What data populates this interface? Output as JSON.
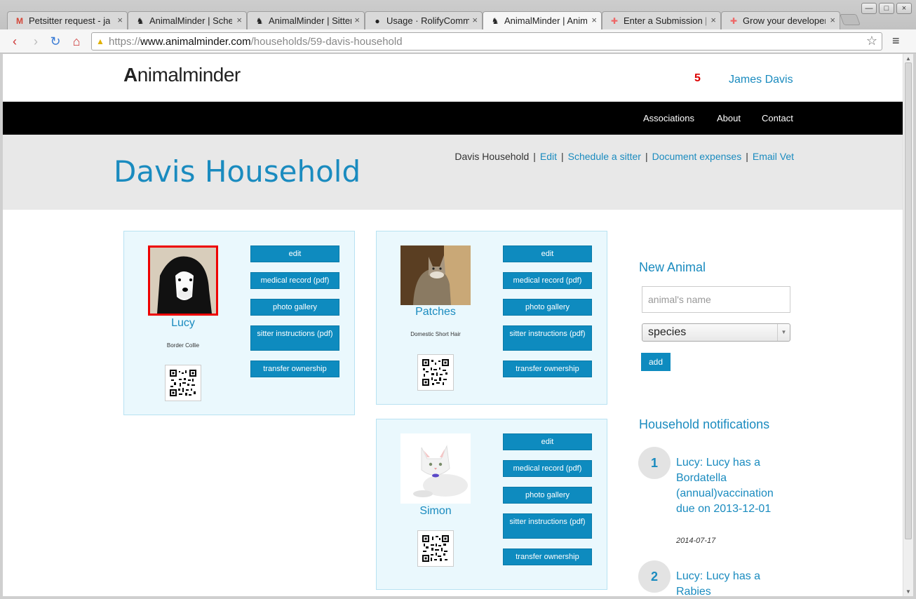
{
  "browser": {
    "tabs": [
      {
        "title": "Petsitter request - ja",
        "icon": "gmail-icon"
      },
      {
        "title": "AnimalMinder | Schec",
        "icon": "animalminder-icon"
      },
      {
        "title": "AnimalMinder | Sitter",
        "icon": "animalminder-icon"
      },
      {
        "title": "Usage · RolifyCommu",
        "icon": "github-icon"
      },
      {
        "title": "AnimalMinder | Anim",
        "icon": "animalminder-icon"
      },
      {
        "title": "Enter a Submission | C",
        "icon": "puzzle-icon"
      },
      {
        "title": "Grow your developer",
        "icon": "puzzle-icon"
      }
    ],
    "url_scheme": "https://",
    "url_host": "www.animalminder.com",
    "url_path": "/households/59-davis-household"
  },
  "header": {
    "logo_text_a": "A",
    "logo_text_b": "nimalminder",
    "notification_count": "5",
    "user_name": "James Davis"
  },
  "nav": {
    "associations": "Associations",
    "about": "About",
    "contact": "Contact"
  },
  "hero": {
    "title": "Davis Household",
    "crumbs": {
      "current": "Davis Household",
      "edit": "Edit",
      "schedule": "Schedule a sitter",
      "expenses": "Document expenses",
      "email_vet": "Email Vet",
      "separator": "|"
    }
  },
  "animals": [
    {
      "name": "Lucy",
      "breed": "Border Collie"
    },
    {
      "name": "Patches",
      "breed": "Domestic Short Hair"
    },
    {
      "name": "Simon",
      "breed": ""
    }
  ],
  "card_buttons": {
    "edit": "edit",
    "medical": "medical record (pdf)",
    "gallery": "photo gallery",
    "sitter": "sitter instructions (pdf)",
    "transfer": "transfer ownership"
  },
  "new_animal": {
    "heading": "New Animal",
    "name_placeholder": "animal's name",
    "species_selected": "species",
    "add_label": "add"
  },
  "notifications": {
    "heading": "Household notifications",
    "items": [
      {
        "number": "1",
        "text": "Lucy: Lucy has a Bordatella (annual)vaccination due on 2013-12-01",
        "date": "2014-07-17"
      },
      {
        "number": "2",
        "text": "Lucy: Lucy has a Rabies",
        "date": ""
      }
    ]
  },
  "colors": {
    "accent": "#1a8bbf",
    "button": "#0e8bbf",
    "card_bg": "#eaf8fd",
    "navbar": "#000000"
  }
}
